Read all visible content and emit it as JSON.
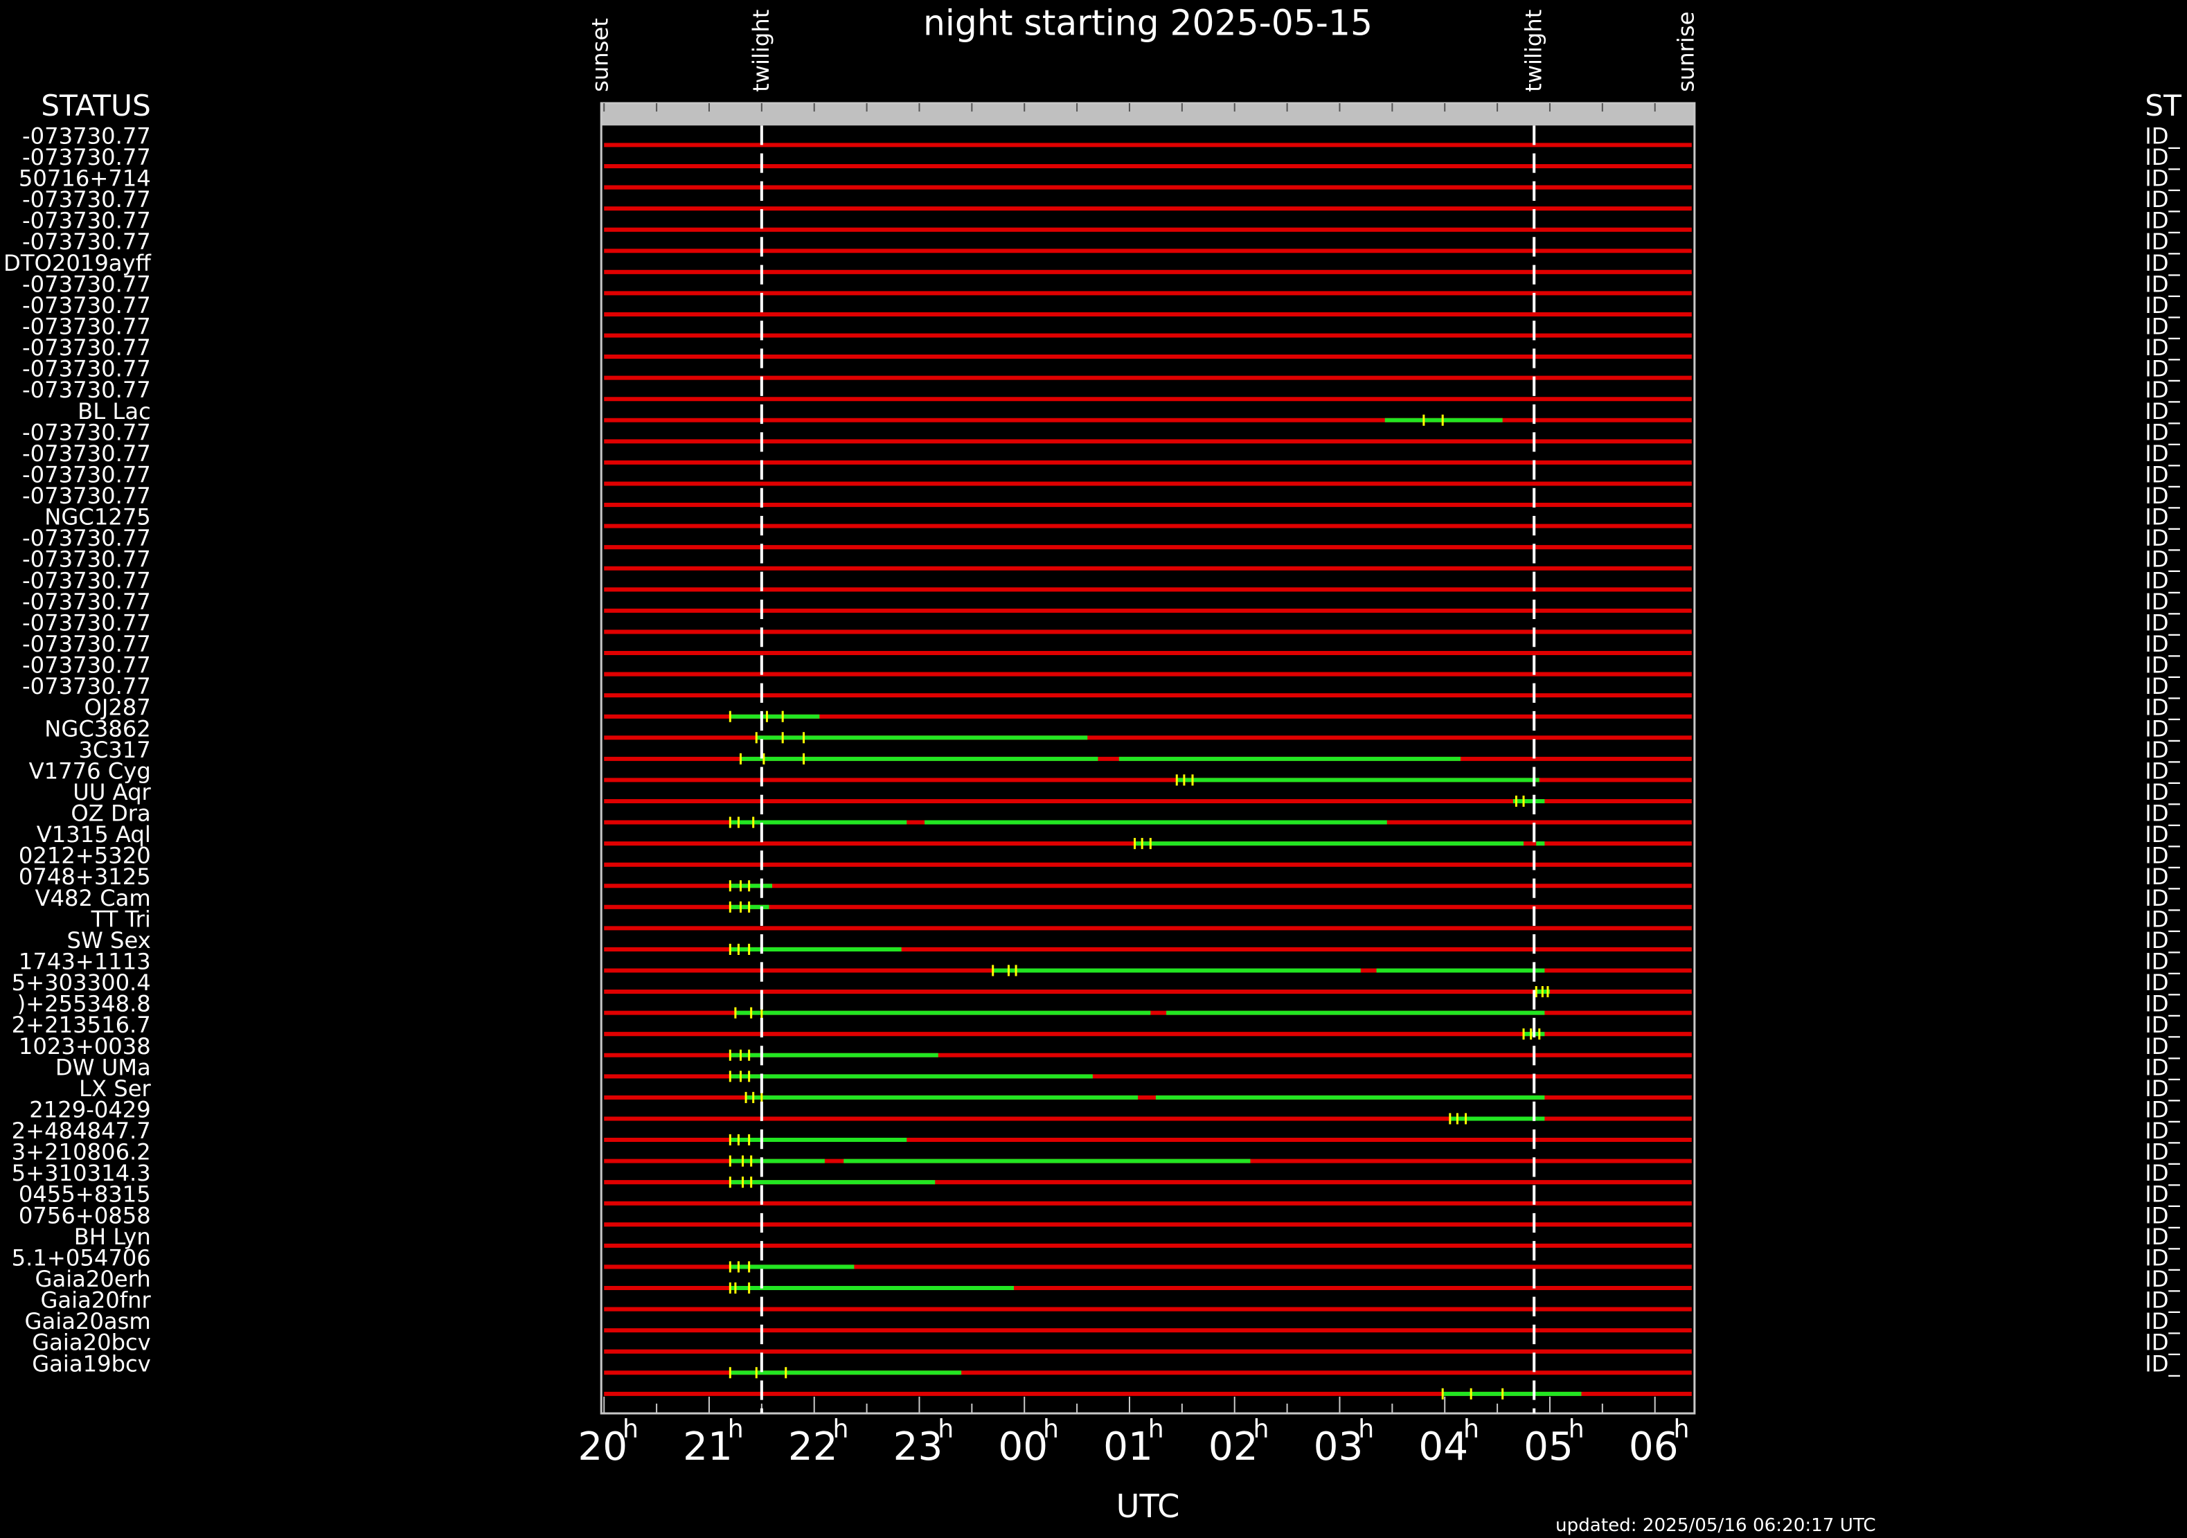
{
  "chart_data": {
    "type": "timeline",
    "title": "night starting 2025-05-15",
    "xlabel": "UTC",
    "updated": "updated: 2025/05/16 06:20:17 UTC",
    "left_header": "STATUS",
    "right_header": "ST",
    "right_id_prefix": "ID_",
    "top_markers": [
      {
        "label": "sunset",
        "hour": 19.97
      },
      {
        "label": "twilight",
        "hour": 21.5
      },
      {
        "label": "twilight",
        "hour": 28.85
      },
      {
        "label": "sunrise",
        "hour": 30.3
      }
    ],
    "twilight_hours": [
      21.5,
      28.85
    ],
    "x_range_hours": [
      20.0,
      30.35
    ],
    "x_ticks": [
      {
        "hour": 20,
        "label": "20",
        "sup": "h"
      },
      {
        "hour": 21,
        "label": "21",
        "sup": "h"
      },
      {
        "hour": 22,
        "label": "22",
        "sup": "h"
      },
      {
        "hour": 23,
        "label": "23",
        "sup": "h"
      },
      {
        "hour": 24,
        "label": "00",
        "sup": "h"
      },
      {
        "hour": 25,
        "label": "01",
        "sup": "h"
      },
      {
        "hour": 26,
        "label": "02",
        "sup": "h"
      },
      {
        "hour": 27,
        "label": "03",
        "sup": "h"
      },
      {
        "hour": 28,
        "label": "04",
        "sup": "h"
      },
      {
        "hour": 29,
        "label": "05",
        "sup": "h"
      },
      {
        "hour": 30,
        "label": "06",
        "sup": "h"
      }
    ],
    "colors": {
      "unobservable": "#e00000",
      "observable": "#22e622",
      "marker": "#ffff00",
      "twilight": "#ffffff",
      "frame": "#c8c8c8"
    },
    "rows": [
      {
        "name": "-073730.77",
        "segments": []
      },
      {
        "name": "-073730.77",
        "segments": []
      },
      {
        "name": "50716+714",
        "segments": []
      },
      {
        "name": "-073730.77",
        "segments": []
      },
      {
        "name": "-073730.77",
        "segments": []
      },
      {
        "name": "-073730.77",
        "segments": []
      },
      {
        "name": "DTO2019ayff",
        "segments": []
      },
      {
        "name": "-073730.77",
        "segments": []
      },
      {
        "name": "-073730.77",
        "segments": []
      },
      {
        "name": "-073730.77",
        "segments": []
      },
      {
        "name": "-073730.77",
        "segments": []
      },
      {
        "name": "-073730.77",
        "segments": []
      },
      {
        "name": "-073730.77",
        "segments": []
      },
      {
        "name": "BL Lac",
        "segments": [
          [
            27.43,
            28.55
          ]
        ],
        "ticks": [
          27.8,
          27.98
        ]
      },
      {
        "name": "-073730.77",
        "segments": []
      },
      {
        "name": "-073730.77",
        "segments": []
      },
      {
        "name": "-073730.77",
        "segments": []
      },
      {
        "name": "-073730.77",
        "segments": []
      },
      {
        "name": "NGC1275",
        "segments": []
      },
      {
        "name": "-073730.77",
        "segments": []
      },
      {
        "name": "-073730.77",
        "segments": []
      },
      {
        "name": "-073730.77",
        "segments": []
      },
      {
        "name": "-073730.77",
        "segments": []
      },
      {
        "name": "-073730.77",
        "segments": []
      },
      {
        "name": "-073730.77",
        "segments": []
      },
      {
        "name": "-073730.77",
        "segments": []
      },
      {
        "name": "-073730.77",
        "segments": []
      },
      {
        "name": "OJ287",
        "segments": [
          [
            21.2,
            22.05
          ]
        ],
        "ticks": [
          21.2,
          21.55,
          21.7
        ]
      },
      {
        "name": "NGC3862",
        "segments": [
          [
            21.45,
            24.6
          ]
        ],
        "ticks": [
          21.45,
          21.7,
          21.9
        ]
      },
      {
        "name": "3C317",
        "segments": [
          [
            21.3,
            24.7
          ],
          [
            24.9,
            28.15
          ]
        ],
        "ticks": [
          21.3,
          21.52,
          21.9
        ]
      },
      {
        "name": "V1776 Cyg",
        "segments": [
          [
            25.45,
            28.9
          ]
        ],
        "ticks": [
          25.45,
          25.52,
          25.6
        ]
      },
      {
        "name": "UU Aqr",
        "segments": [
          [
            28.65,
            28.95
          ]
        ],
        "ticks": [
          28.68,
          28.75,
          28.85
        ]
      },
      {
        "name": "OZ Dra",
        "segments": [
          [
            21.2,
            22.88
          ],
          [
            23.05,
            27.45
          ]
        ],
        "ticks": [
          21.2,
          21.28,
          21.42
        ]
      },
      {
        "name": "V1315 Aql",
        "segments": [
          [
            25.05,
            28.75
          ],
          [
            28.87,
            28.95
          ]
        ],
        "ticks": [
          25.05,
          25.12,
          25.2
        ]
      },
      {
        "name": "0212+5320",
        "segments": []
      },
      {
        "name": "0748+3125",
        "segments": [
          [
            21.2,
            21.6
          ]
        ],
        "ticks": [
          21.2,
          21.3,
          21.38
        ]
      },
      {
        "name": "V482 Cam",
        "segments": [
          [
            21.2,
            21.57
          ]
        ],
        "ticks": [
          21.2,
          21.3,
          21.38
        ]
      },
      {
        "name": "TT Tri",
        "segments": []
      },
      {
        "name": "SW Sex",
        "segments": [
          [
            21.2,
            22.83
          ]
        ],
        "ticks": [
          21.2,
          21.28,
          21.38
        ]
      },
      {
        "name": "1743+1113",
        "segments": [
          [
            23.7,
            27.2
          ],
          [
            27.35,
            28.95
          ]
        ],
        "ticks": [
          23.7,
          23.85,
          23.92
        ]
      },
      {
        "name": "5+303300.4",
        "segments": [
          [
            28.85,
            29.0
          ]
        ],
        "ticks": [
          28.87,
          28.93,
          28.98
        ]
      },
      {
        "name": ")+255348.8",
        "segments": [
          [
            21.25,
            25.2
          ],
          [
            25.35,
            28.95
          ]
        ],
        "ticks": [
          21.25,
          21.4,
          21.5
        ]
      },
      {
        "name": "2+213516.7",
        "segments": [
          [
            28.75,
            28.95
          ]
        ],
        "ticks": [
          28.75,
          28.82,
          28.9
        ]
      },
      {
        "name": "1023+0038",
        "segments": [
          [
            21.2,
            23.18
          ]
        ],
        "ticks": [
          21.2,
          21.3,
          21.38
        ]
      },
      {
        "name": "DW UMa",
        "segments": [
          [
            21.2,
            24.65
          ]
        ],
        "ticks": [
          21.2,
          21.3,
          21.38
        ]
      },
      {
        "name": "LX Ser",
        "segments": [
          [
            21.35,
            25.08
          ],
          [
            25.25,
            28.95
          ]
        ],
        "ticks": [
          21.35,
          21.42,
          21.5
        ]
      },
      {
        "name": "2129-0429",
        "segments": [
          [
            28.05,
            28.95
          ]
        ],
        "ticks": [
          28.05,
          28.12,
          28.2
        ]
      },
      {
        "name": "2+484847.7",
        "segments": [
          [
            21.2,
            22.88
          ]
        ],
        "ticks": [
          21.2,
          21.28,
          21.38
        ]
      },
      {
        "name": "3+210806.2",
        "segments": [
          [
            21.2,
            22.1
          ],
          [
            22.28,
            26.15
          ]
        ],
        "ticks": [
          21.2,
          21.32,
          21.4
        ]
      },
      {
        "name": "5+310314.3",
        "segments": [
          [
            21.2,
            23.15
          ]
        ],
        "ticks": [
          21.2,
          21.32,
          21.4
        ]
      },
      {
        "name": "0455+8315",
        "segments": []
      },
      {
        "name": "0756+0858",
        "segments": []
      },
      {
        "name": "BH Lyn",
        "segments": []
      },
      {
        "name": "5.1+054706",
        "segments": [
          [
            21.2,
            22.38
          ]
        ],
        "ticks": [
          21.2,
          21.28,
          21.38
        ]
      },
      {
        "name": "Gaia20erh",
        "segments": [
          [
            21.2,
            23.9
          ]
        ],
        "ticks": [
          21.2,
          21.25,
          21.38
        ]
      },
      {
        "name": "Gaia20fnr",
        "segments": []
      },
      {
        "name": "Gaia20asm",
        "segments": []
      },
      {
        "name": "Gaia20bcv",
        "segments": []
      },
      {
        "name": "Gaia19bcv",
        "segments": [
          [
            21.2,
            23.4
          ]
        ],
        "ticks": [
          21.2,
          21.45,
          21.73
        ]
      },
      {
        "name": "",
        "segments": [
          [
            27.98,
            29.3
          ]
        ],
        "ticks": [
          27.98,
          28.25,
          28.55
        ]
      }
    ]
  }
}
